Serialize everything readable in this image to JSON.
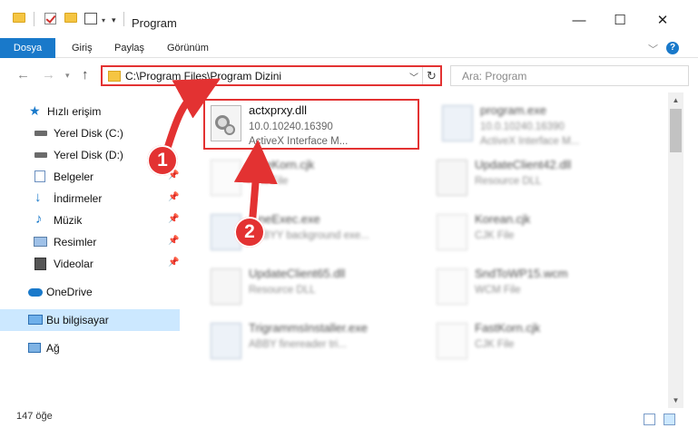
{
  "window": {
    "title": "Program",
    "minimize_glyph": "—",
    "maximize_glyph": "☐",
    "close_glyph": "✕"
  },
  "ribbon": {
    "tabs": [
      {
        "label": "Dosya",
        "active": true
      },
      {
        "label": "Giriş",
        "active": false
      },
      {
        "label": "Paylaş",
        "active": false
      },
      {
        "label": "Görünüm",
        "active": false
      }
    ],
    "help_label": "?"
  },
  "address": {
    "path": "C:\\Program Files\\Program Dizini",
    "search_placeholder": "Ara: Program"
  },
  "sidebar": {
    "items": [
      {
        "label": "Hızlı erişim",
        "icon": "star-icon",
        "pinned": false
      },
      {
        "label": "Yerel Disk (C:)",
        "icon": "drive-icon",
        "pinned": false
      },
      {
        "label": "Yerel Disk (D:)",
        "icon": "drive-icon",
        "pinned": false
      },
      {
        "label": "Belgeler",
        "icon": "documents-icon",
        "pinned": true
      },
      {
        "label": "İndirmeler",
        "icon": "download-icon",
        "pinned": true
      },
      {
        "label": "Müzik",
        "icon": "music-icon",
        "pinned": true
      },
      {
        "label": "Resimler",
        "icon": "pictures-icon",
        "pinned": true
      },
      {
        "label": "Videolar",
        "icon": "video-icon",
        "pinned": true
      },
      {
        "label": "OneDrive",
        "icon": "cloud-icon",
        "pinned": false
      },
      {
        "label": "Bu bilgisayar",
        "icon": "computer-icon",
        "pinned": false,
        "selected": true
      },
      {
        "label": "Ağ",
        "icon": "network-icon",
        "pinned": false
      }
    ]
  },
  "files": [
    {
      "name": "actxprxy.dll",
      "line2": "10.0.10240.16390",
      "line3": "ActiveX Interface M...",
      "icon": "dll-gear-icon"
    },
    {
      "name": "program.exe",
      "line2": "10.0.10240.16390",
      "line3": "ActiveX Interface M...",
      "icon": "exe-icon"
    },
    {
      "name": "FineKorn.cjk",
      "line2": "CJK File",
      "line3": "",
      "icon": "document-icon"
    },
    {
      "name": "UpdateClient42.dll",
      "line2": "Resource DLL",
      "line3": "",
      "icon": "dll-gear-icon"
    },
    {
      "name": "FineExec.exe",
      "line2": "ABBYY background exe...",
      "line3": "",
      "icon": "exe-icon"
    },
    {
      "name": "Korean.cjk",
      "line2": "CJK File",
      "line3": "",
      "icon": "document-icon"
    },
    {
      "name": "UpdateClient65.dll",
      "line2": "Resource DLL",
      "line3": "",
      "icon": "dll-gear-icon"
    },
    {
      "name": "SndToWP15.wcm",
      "line2": "WCM File",
      "line3": "",
      "icon": "document-icon"
    },
    {
      "name": "TrigrammsInstaller.exe",
      "line2": "ABBY finereader tri...",
      "line3": "",
      "icon": "exe-icon"
    },
    {
      "name": "FastKorn.cjk",
      "line2": "CJK File",
      "line3": "",
      "icon": "document-icon"
    }
  ],
  "status": {
    "item_count": "147 öğe"
  },
  "callouts": [
    "1",
    "2"
  ],
  "colors": {
    "accent": "#1979ca",
    "highlight": "#e33232",
    "selection": "#cce8ff"
  }
}
